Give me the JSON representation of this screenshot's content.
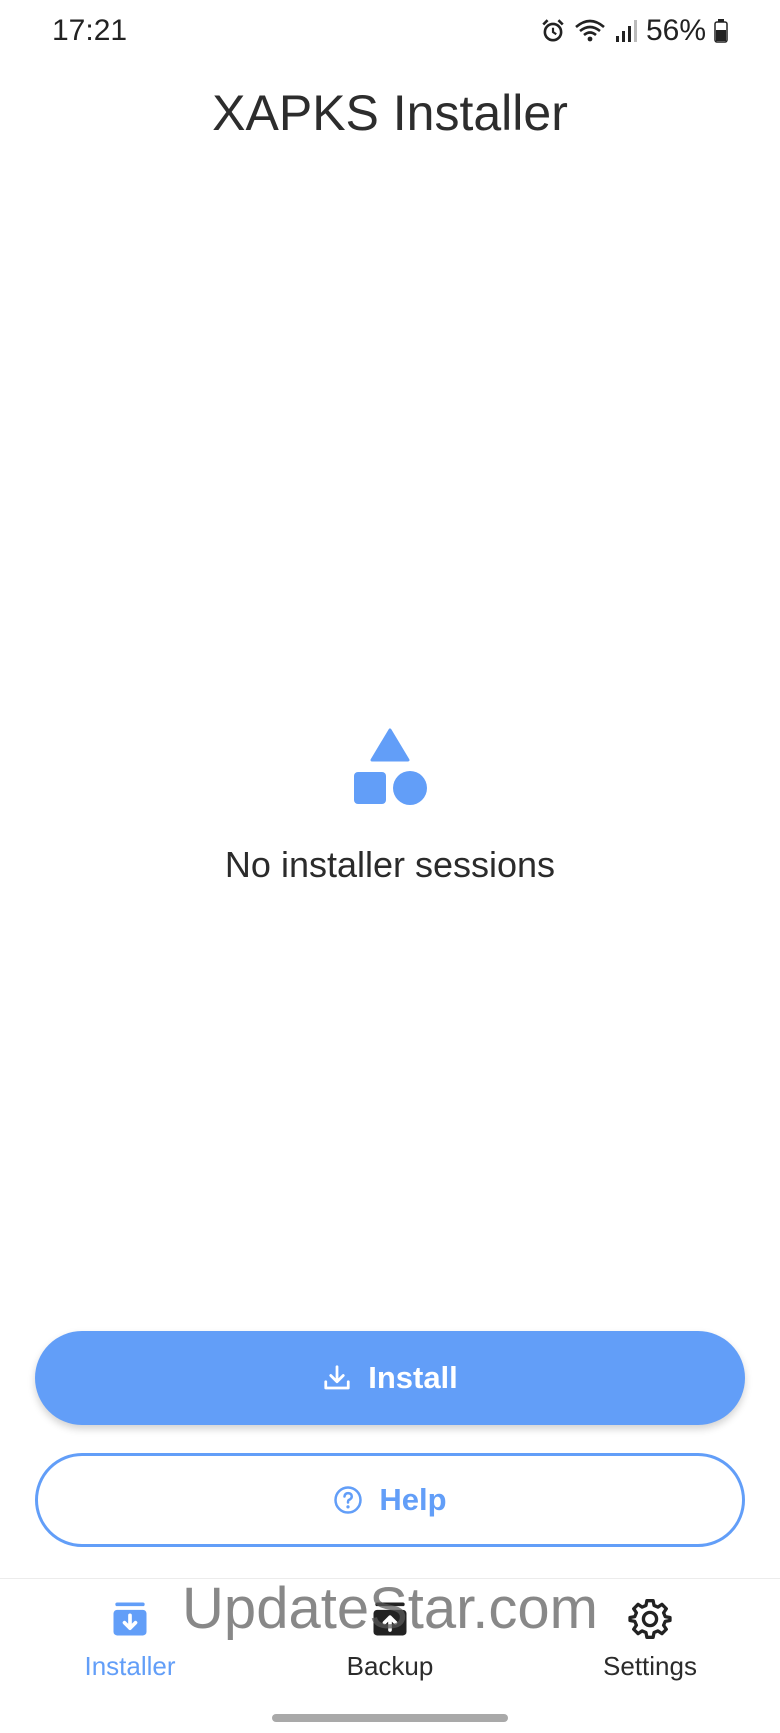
{
  "status_bar": {
    "time": "17:21",
    "battery_percent": "56%",
    "icons": [
      "alarm-icon",
      "wifi-icon",
      "signal-icon",
      "battery-icon"
    ]
  },
  "header": {
    "title": "XAPKS Installer"
  },
  "empty_state": {
    "icon": "shapes-icon",
    "message": "No installer sessions"
  },
  "actions": {
    "install": {
      "label": "Install",
      "icon": "download-icon"
    },
    "help": {
      "label": "Help",
      "icon": "help-circle-icon"
    }
  },
  "bottom_nav": {
    "items": [
      {
        "label": "Installer",
        "icon": "installer-icon",
        "active": true
      },
      {
        "label": "Backup",
        "icon": "backup-icon",
        "active": false
      },
      {
        "label": "Settings",
        "icon": "gear-icon",
        "active": false
      }
    ]
  },
  "watermark": "UpdateStar.com",
  "colors": {
    "accent": "#629ef8",
    "text": "#2b2b2b",
    "background": "#ffffff"
  }
}
